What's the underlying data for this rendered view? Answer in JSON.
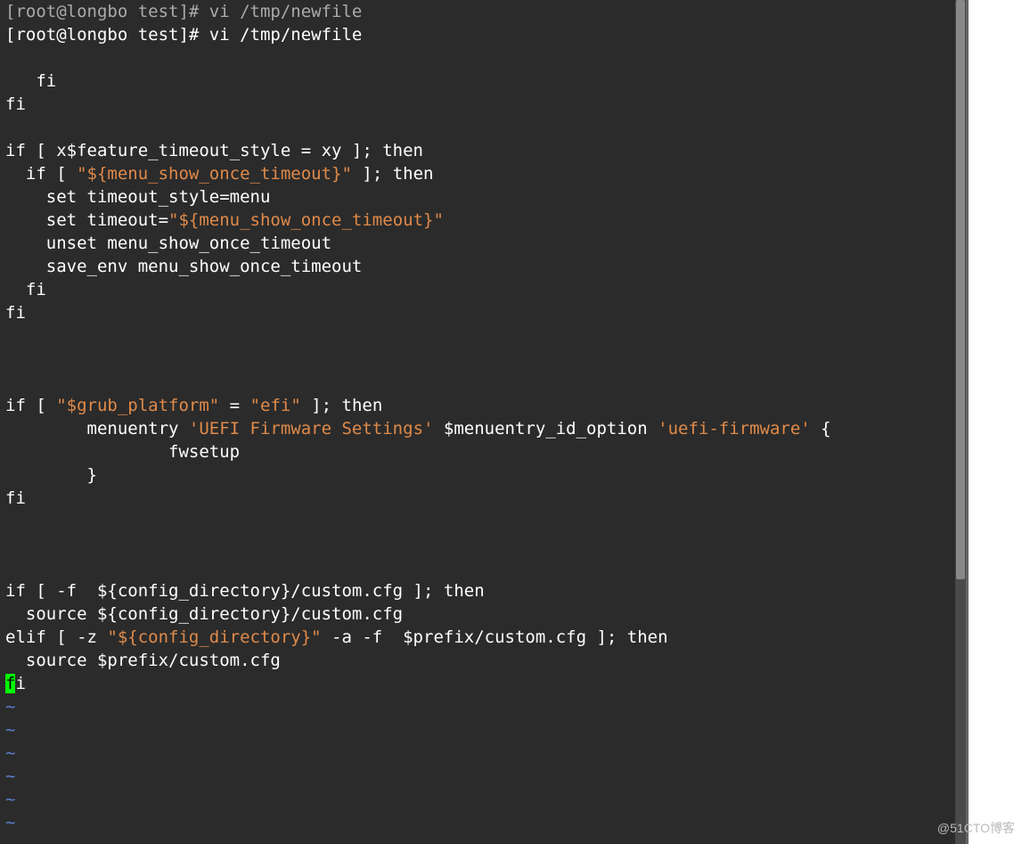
{
  "prompt": {
    "partial": "[root@longbo test]# vi /tmp/newfile",
    "full": "[root@longbo test]# vi /tmp/newfile"
  },
  "lines": {
    "l1": "   fi",
    "l2": "fi",
    "l3": "",
    "l4a": "if [ x$feature_timeout_style = xy ]; then",
    "l5a": "  if [ ",
    "l5b": "\"${menu_show_once_timeout}\"",
    "l5c": " ]; then",
    "l6": "    set timeout_style=menu",
    "l7a": "    set timeout=",
    "l7b": "\"${menu_show_once_timeout}\"",
    "l8": "    unset menu_show_once_timeout",
    "l9": "    save_env menu_show_once_timeout",
    "l10": "  fi",
    "l11": "fi",
    "l15a": "if [ ",
    "l15b": "\"$grub_platform\"",
    "l15c": " = ",
    "l15d": "\"efi\"",
    "l15e": " ]; then",
    "l16a": "        menuentry ",
    "l16b": "'UEFI Firmware Settings'",
    "l16c": " $menuentry_id_option ",
    "l16d": "'uefi-firmware'",
    "l16e": " {",
    "l17": "                fwsetup",
    "l18": "        }",
    "l19": "fi",
    "l23": "if [ -f  ${config_directory}/custom.cfg ]; then",
    "l24": "  source ${config_directory}/custom.cfg",
    "l25a": "elif [ -z ",
    "l25b": "\"${config_directory}\"",
    "l25c": " -a -f  $prefix/custom.cfg ]; then",
    "l26": "  source $prefix/custom.cfg",
    "l27a": "f",
    "l27b": "i",
    "tilde": "~"
  },
  "watermark": "@51CTO博客"
}
